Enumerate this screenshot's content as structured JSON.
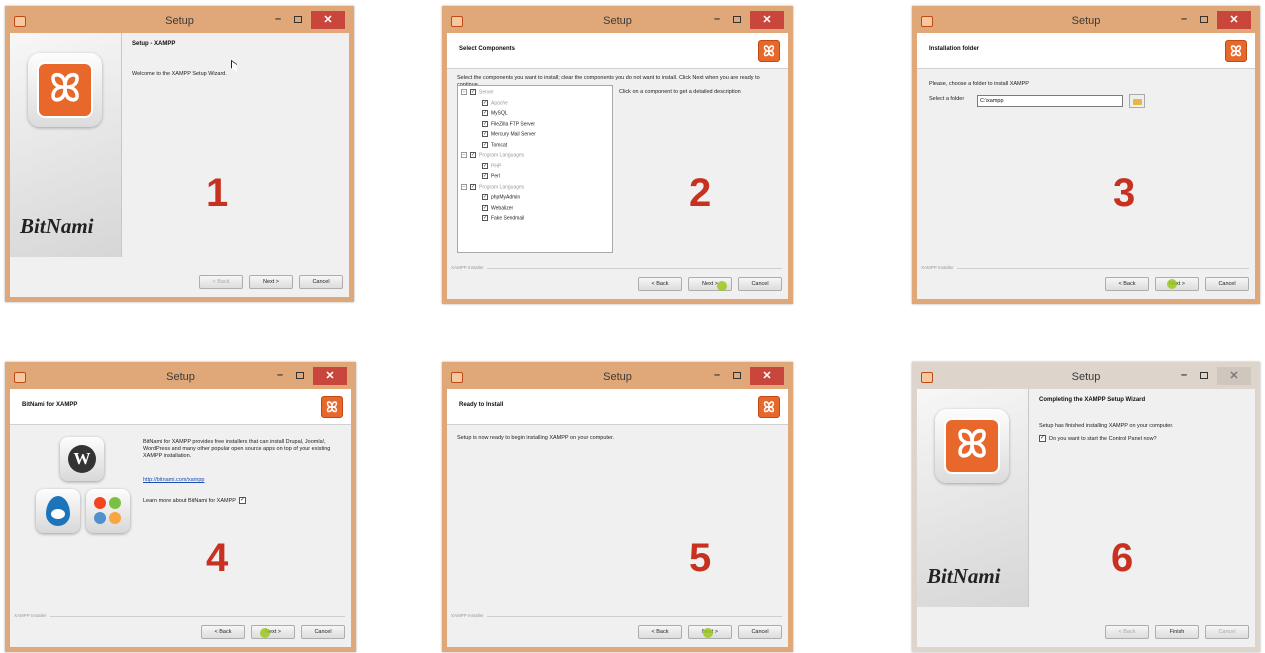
{
  "window_title": "Setup",
  "controls": {
    "minimize": "–",
    "close": "✕"
  },
  "buttons": {
    "back": "< Back",
    "next": "Next >",
    "cancel": "Cancel",
    "finish": "Finish"
  },
  "footer_label": "XAMPP Installer",
  "brand": "BitNami",
  "logo_glyph": "ꕤ",
  "step1": {
    "number": "1",
    "title": "Setup - XAMPP",
    "text": "Welcome to the XAMPP Setup Wizard."
  },
  "step2": {
    "number": "2",
    "title": "Select Components",
    "intro": "Select the components you want to install; clear the components you do not want to install. Click Next when you are ready to continue.",
    "description_hint": "Click on a component to get a detailed description",
    "tree": [
      {
        "label": "Server",
        "level": 0,
        "dim": true
      },
      {
        "label": "Apache",
        "level": 1,
        "dim": true
      },
      {
        "label": "MySQL",
        "level": 1,
        "dim": false
      },
      {
        "label": "FileZilla FTP Server",
        "level": 1,
        "dim": false
      },
      {
        "label": "Mercury Mail Server",
        "level": 1,
        "dim": false
      },
      {
        "label": "Tomcat",
        "level": 1,
        "dim": false
      },
      {
        "label": "Program Languages",
        "level": 0,
        "dim": true
      },
      {
        "label": "PHP",
        "level": 1,
        "dim": true
      },
      {
        "label": "Perl",
        "level": 1,
        "dim": false
      },
      {
        "label": "Program Languages",
        "level": 0,
        "dim": true
      },
      {
        "label": "phpMyAdmin",
        "level": 1,
        "dim": false
      },
      {
        "label": "Webalizer",
        "level": 1,
        "dim": false
      },
      {
        "label": "Fake Sendmail",
        "level": 1,
        "dim": false
      }
    ]
  },
  "step3": {
    "number": "3",
    "title": "Installation folder",
    "intro": "Please, choose a folder to install XAMPP",
    "folder_label": "Select a folder",
    "folder_value": "C:\\xampp"
  },
  "step4": {
    "number": "4",
    "title": "BitNami for XAMPP",
    "text": "BitNami for XAMPP provides free installers that can install Drupal, Joomla!, WordPress and many other popular open source apps on top of your existing XAMPP installation.",
    "link": "http://bitnami.com/xampp",
    "learn_more": "Learn more about BitNami for XAMPP"
  },
  "step5": {
    "number": "5",
    "title": "Ready to Install",
    "text": "Setup is now ready to begin installing XAMPP on your computer."
  },
  "step6": {
    "number": "6",
    "title": "Completing the XAMPP Setup Wizard",
    "text": "Setup has finished installing XAMPP on your computer.",
    "checkbox_label": "Do you want to start the Control Panel now?"
  }
}
